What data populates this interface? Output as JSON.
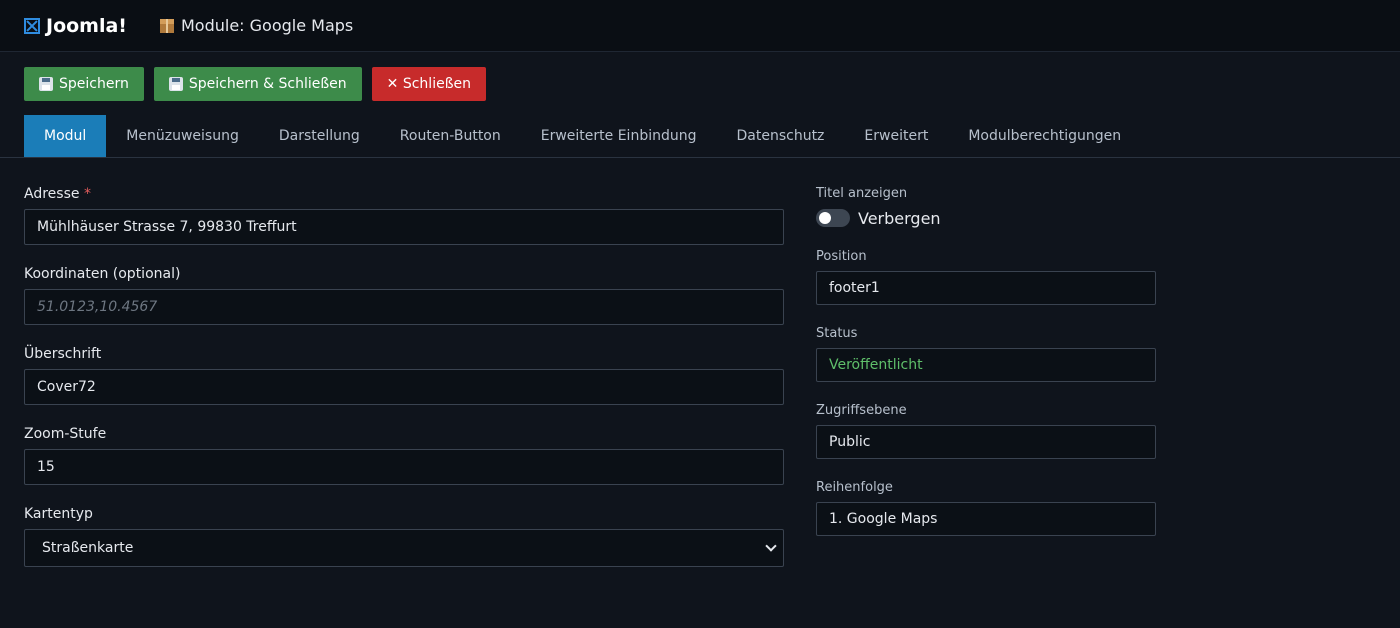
{
  "header": {
    "brand": "Joomla!",
    "page_title": "Module: Google Maps"
  },
  "toolbar": {
    "save_label": "Speichern",
    "save_close_label": "Speichern & Schließen",
    "close_label": "✕ Schließen"
  },
  "tabs": [
    {
      "label": "Modul",
      "active": true
    },
    {
      "label": "Menüzuweisung"
    },
    {
      "label": "Darstellung"
    },
    {
      "label": "Routen-Button"
    },
    {
      "label": "Erweiterte Einbindung"
    },
    {
      "label": "Datenschutz"
    },
    {
      "label": "Erweitert"
    },
    {
      "label": "Modulberechtigungen"
    }
  ],
  "form": {
    "address": {
      "label": "Adresse",
      "required_mark": "*",
      "value": "Mühlhäuser Strasse 7, 99830 Treffurt"
    },
    "coordinates": {
      "label": "Koordinaten (optional)",
      "placeholder": "51.0123,10.4567"
    },
    "heading": {
      "label": "Überschrift",
      "value": "Cover72"
    },
    "zoom": {
      "label": "Zoom-Stufe",
      "value": "15"
    },
    "map_type": {
      "label": "Kartentyp",
      "value": "Straßenkarte"
    }
  },
  "sidebar": {
    "show_title": {
      "label": "Titel anzeigen",
      "value": "Verbergen",
      "enabled": false
    },
    "position": {
      "label": "Position",
      "value": "footer1"
    },
    "status": {
      "label": "Status",
      "value": "Veröffentlicht"
    },
    "access": {
      "label": "Zugriffsebene",
      "value": "Public"
    },
    "ordering": {
      "label": "Reihenfolge",
      "value": "1. Google Maps"
    }
  },
  "colors": {
    "background": "#0f141c",
    "accent_tab": "#1b7db8",
    "save_green": "#3d8b4a",
    "close_red": "#c72b2b",
    "status_green": "#5fbf6a"
  }
}
